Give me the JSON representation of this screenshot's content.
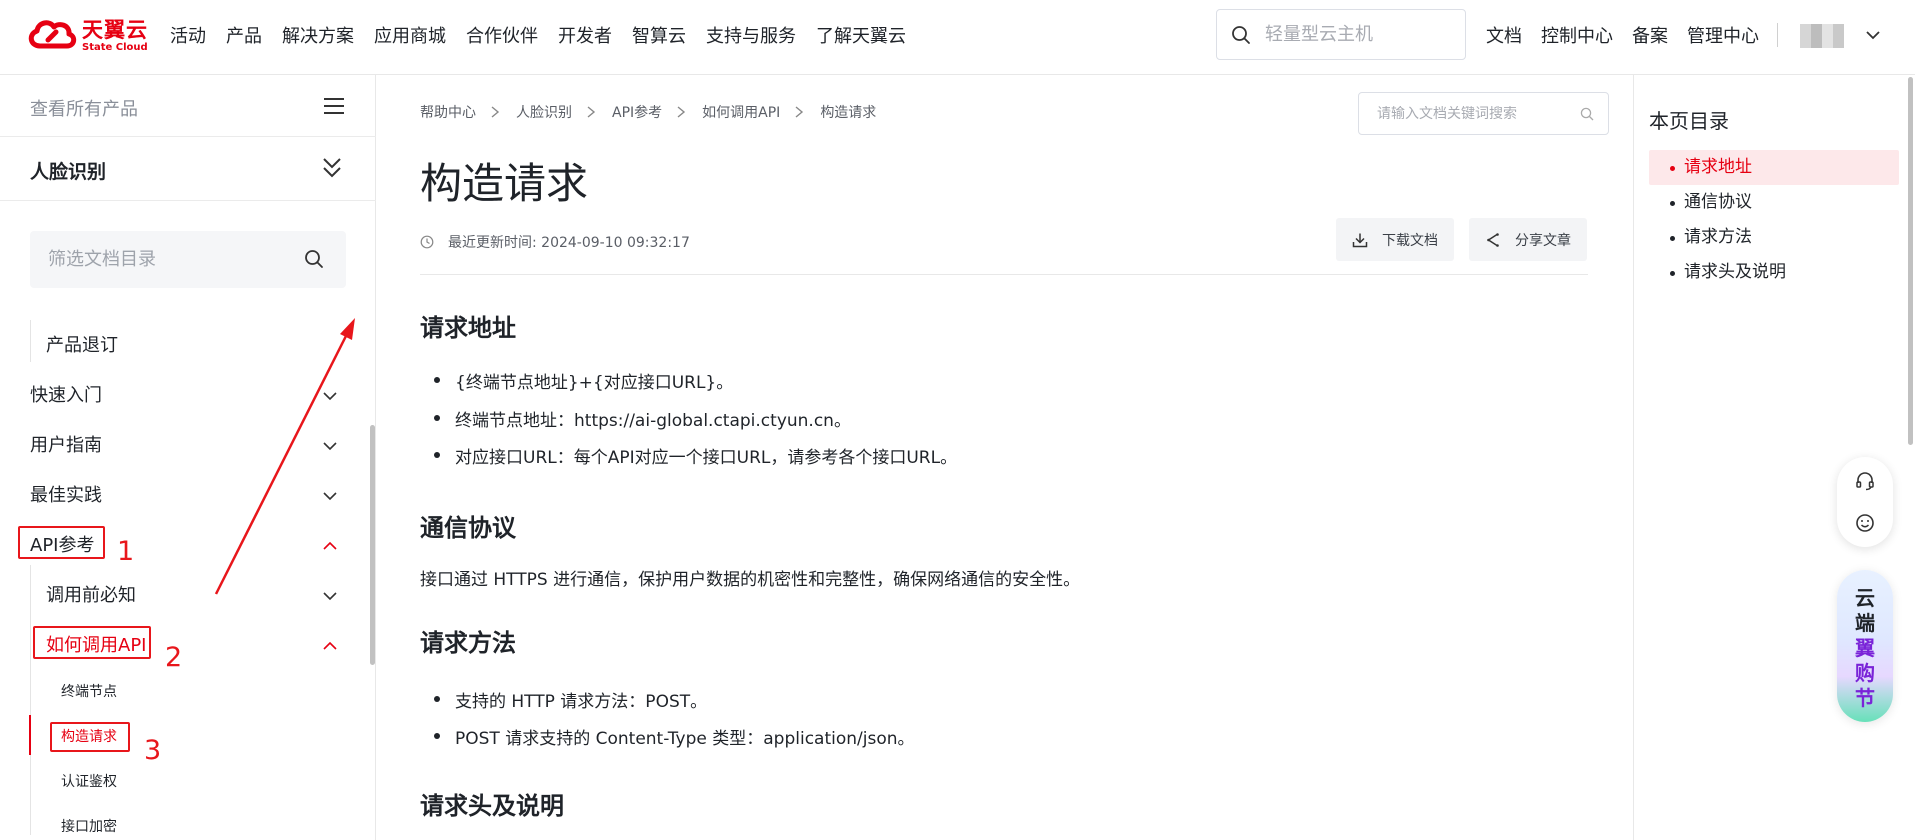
{
  "brand": {
    "name_cn": "天翼云",
    "name_en": "State Cloud",
    "color": "#e60012"
  },
  "nav": [
    "活动",
    "产品",
    "解决方案",
    "应用商城",
    "合作伙伴",
    "开发者",
    "智算云",
    "支持与服务",
    "了解天翼云"
  ],
  "top_search": {
    "placeholder": "轻量型云主机"
  },
  "top_links": [
    "文档",
    "控制中心",
    "备案",
    "管理中心"
  ],
  "sidebar": {
    "all_products": "查看所有产品",
    "product_title": "人脸识别",
    "filter_placeholder": "筛选文档目录",
    "items": {
      "product_unsubscribe": "产品退订",
      "quick_start": "快速入门",
      "user_guide": "用户指南",
      "best_practice": "最佳实践",
      "api_reference": "API参考",
      "before_call": "调用前必知",
      "how_to_call": "如何调用API",
      "endpoint": "终端节点",
      "construct_request": "构造请求",
      "auth": "认证鉴权",
      "encryption": "接口加密"
    }
  },
  "annotations": {
    "n1": "1",
    "n2": "2",
    "n3": "3",
    "color": "#e8161b"
  },
  "breadcrumb": [
    "帮助中心",
    "人脸识别",
    "API参考",
    "如何调用API",
    "构造请求"
  ],
  "doc_search": {
    "placeholder": "请输入文档关键词搜索"
  },
  "page": {
    "title": "构造请求",
    "updated": "最近更新时间: 2024-09-10 09:32:17",
    "download": "下载文档",
    "share": "分享文章"
  },
  "sections": {
    "addr_title": "请求地址",
    "addr_bullets": [
      "{终端节点地址}+{对应接口URL}。",
      "终端节点地址：https://ai-global.ctapi.ctyun.cn。",
      "对应接口URL：每个API对应一个接口URL，请参考各个接口URL。"
    ],
    "proto_title": "通信协议",
    "proto_text": "接口通过 HTTPS 进行通信，保护用户数据的机密性和完整性，确保网络通信的安全性。",
    "method_title": "请求方法",
    "method_bullets": [
      "支持的 HTTP 请求方法：POST。",
      "POST 请求支持的 Content-Type 类型：application/json。"
    ],
    "header_title": "请求头及说明"
  },
  "toc": {
    "title": "本页目录",
    "items": [
      "请求地址",
      "通信协议",
      "请求方法",
      "请求头及说明"
    ],
    "active_color": "#e60012"
  },
  "promo": {
    "line1": "云端",
    "line2": "翼购节"
  }
}
